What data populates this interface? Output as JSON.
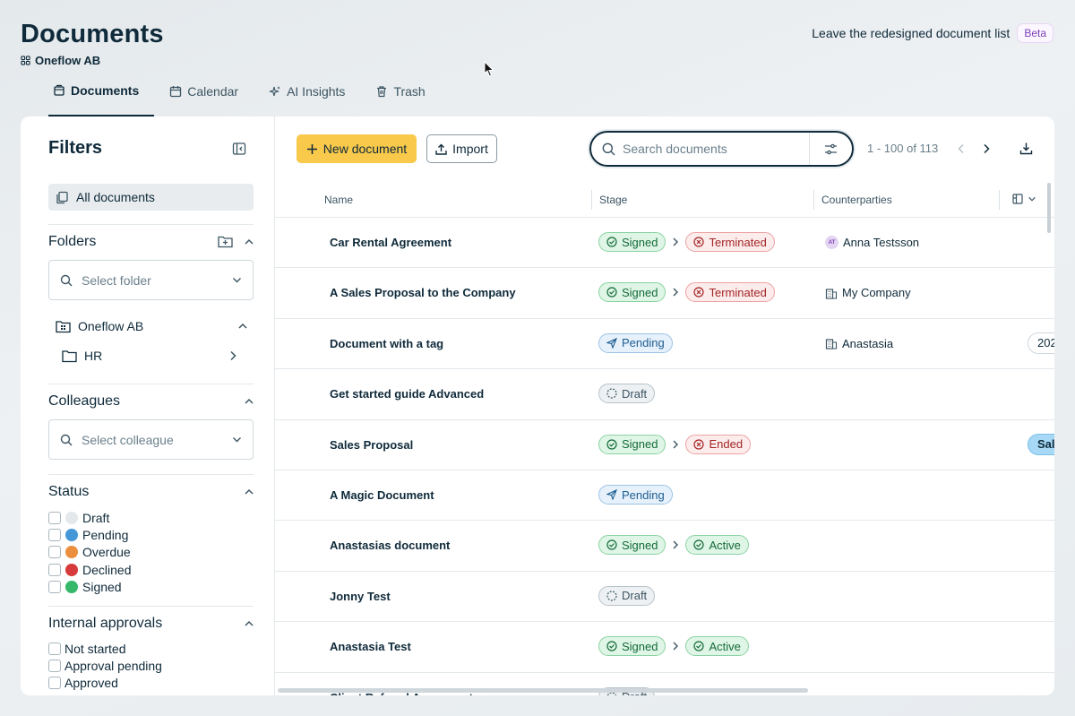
{
  "header": {
    "title": "Documents",
    "workspace": "Oneflow AB",
    "leave_link": "Leave the redesigned document list",
    "beta_badge": "Beta"
  },
  "tabs": [
    {
      "label": "Documents",
      "icon": "document-stack-icon",
      "active": true
    },
    {
      "label": "Calendar",
      "icon": "calendar-icon",
      "active": false
    },
    {
      "label": "AI Insights",
      "icon": "sparkles-icon",
      "active": false
    },
    {
      "label": "Trash",
      "icon": "trash-icon",
      "active": false
    }
  ],
  "sidebar": {
    "title": "Filters",
    "all_documents": "All documents",
    "folders": {
      "title": "Folders",
      "placeholder": "Select folder",
      "tree": [
        {
          "label": "Oneflow AB",
          "expanded": true
        },
        {
          "label": "HR",
          "expanded": false
        }
      ]
    },
    "colleagues": {
      "title": "Colleagues",
      "placeholder": "Select colleague"
    },
    "status": {
      "title": "Status",
      "items": [
        {
          "label": "Draft",
          "color": "#e4e8ea"
        },
        {
          "label": "Pending",
          "color": "#4597d8"
        },
        {
          "label": "Overdue",
          "color": "#eb8f3f"
        },
        {
          "label": "Declined",
          "color": "#d63a3a"
        },
        {
          "label": "Signed",
          "color": "#35b86a"
        }
      ]
    },
    "approvals": {
      "title": "Internal approvals",
      "items": [
        {
          "label": "Not started"
        },
        {
          "label": "Approval pending"
        },
        {
          "label": "Approved"
        }
      ]
    }
  },
  "toolbar": {
    "new_document": "New document",
    "import": "Import",
    "search_placeholder": "Search documents",
    "pagination": "1 - 100 of 113"
  },
  "table": {
    "columns": {
      "name": "Name",
      "stage": "Stage",
      "counterparties": "Counterparties"
    },
    "rows": [
      {
        "name": "Car Rental Agreement",
        "stage": [
          {
            "label": "Signed",
            "type": "signed"
          },
          {
            "label": "Terminated",
            "type": "terminated"
          }
        ],
        "counterparty": "Anna Testsson",
        "cp_kind": "person",
        "cp_initials": "AT",
        "extra": ""
      },
      {
        "name": "A Sales Proposal to the Company",
        "stage": [
          {
            "label": "Signed",
            "type": "signed"
          },
          {
            "label": "Terminated",
            "type": "terminated"
          }
        ],
        "counterparty": "My Company",
        "cp_kind": "company",
        "extra": ""
      },
      {
        "name": "Document with a tag",
        "stage": [
          {
            "label": "Pending",
            "type": "pending"
          }
        ],
        "counterparty": "Anastasia",
        "cp_kind": "company",
        "extra": "202"
      },
      {
        "name": "Get started guide Advanced",
        "stage": [
          {
            "label": "Draft",
            "type": "draft"
          }
        ],
        "counterparty": "",
        "cp_kind": "",
        "extra": ""
      },
      {
        "name": "Sales Proposal",
        "stage": [
          {
            "label": "Signed",
            "type": "signed"
          },
          {
            "label": "Ended",
            "type": "ended"
          }
        ],
        "counterparty": "",
        "cp_kind": "",
        "extra": "Sale",
        "extra_blue": true
      },
      {
        "name": "A Magic Document",
        "stage": [
          {
            "label": "Pending",
            "type": "pending"
          }
        ],
        "counterparty": "",
        "cp_kind": "",
        "extra": ""
      },
      {
        "name": "Anastasias document",
        "stage": [
          {
            "label": "Signed",
            "type": "signed"
          },
          {
            "label": "Active",
            "type": "active"
          }
        ],
        "counterparty": "",
        "cp_kind": "",
        "extra": ""
      },
      {
        "name": "Jonny Test",
        "stage": [
          {
            "label": "Draft",
            "type": "draft"
          }
        ],
        "counterparty": "",
        "cp_kind": "",
        "extra": ""
      },
      {
        "name": "Anastasia Test",
        "stage": [
          {
            "label": "Signed",
            "type": "signed"
          },
          {
            "label": "Active",
            "type": "active"
          }
        ],
        "counterparty": "",
        "cp_kind": "",
        "extra": ""
      },
      {
        "name": "Client Referral Agreement",
        "stage": [
          {
            "label": "Draft",
            "type": "draft"
          }
        ],
        "counterparty": "",
        "cp_kind": "",
        "extra": ""
      }
    ]
  }
}
